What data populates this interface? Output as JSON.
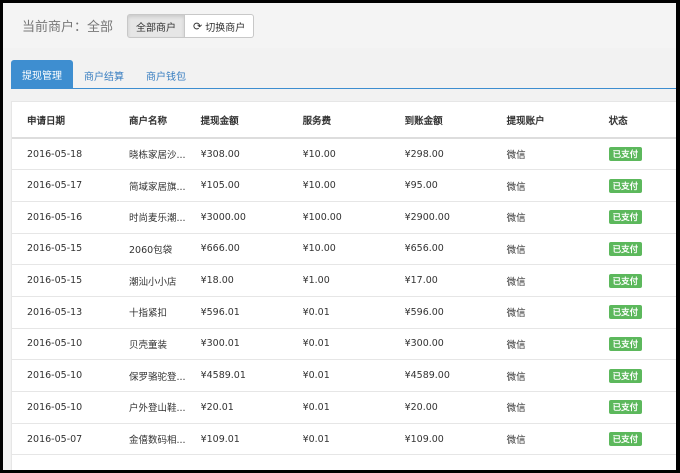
{
  "header": {
    "merchant_label": "当前商户：全部",
    "all_merchants_button": "全部商户",
    "switch_merchant_button": "切换商户"
  },
  "tabs": [
    {
      "label": "提现管理",
      "active": true
    },
    {
      "label": "商户结算",
      "active": false
    },
    {
      "label": "商户钱包",
      "active": false
    }
  ],
  "table": {
    "columns": [
      "申请日期",
      "商户名称",
      "提现金额",
      "服务费",
      "到账金额",
      "提现账户",
      "状态"
    ],
    "rows": [
      [
        "2016-05-18",
        "晓栋家居沙...",
        "¥308.00",
        "¥10.00",
        "¥298.00",
        "微信",
        "已支付"
      ],
      [
        "2016-05-17",
        "简域家居旗...",
        "¥105.00",
        "¥10.00",
        "¥95.00",
        "微信",
        "已支付"
      ],
      [
        "2016-05-16",
        "时尚麦乐潮...",
        "¥3000.00",
        "¥100.00",
        "¥2900.00",
        "微信",
        "已支付"
      ],
      [
        "2016-05-15",
        "2060包袋",
        "¥666.00",
        "¥10.00",
        "¥656.00",
        "微信",
        "已支付"
      ],
      [
        "2016-05-15",
        "潮汕小小店",
        "¥18.00",
        "¥1.00",
        "¥17.00",
        "微信",
        "已支付"
      ],
      [
        "2016-05-13",
        "十指紧扣",
        "¥596.01",
        "¥0.01",
        "¥596.00",
        "微信",
        "已支付"
      ],
      [
        "2016-05-10",
        "贝壳童装",
        "¥300.01",
        "¥0.01",
        "¥300.00",
        "微信",
        "已支付"
      ],
      [
        "2016-05-10",
        "保罗骆驼登...",
        "¥4589.01",
        "¥0.01",
        "¥4589.00",
        "微信",
        "已支付"
      ],
      [
        "2016-05-10",
        "户外登山鞋...",
        "¥20.01",
        "¥0.01",
        "¥20.00",
        "微信",
        "已支付"
      ],
      [
        "2016-05-07",
        "金僖数码相...",
        "¥109.01",
        "¥0.01",
        "¥109.00",
        "微信",
        "已支付"
      ]
    ]
  },
  "colors": {
    "accent": "#3e8ed0",
    "paid_badge": "#5cb85c"
  },
  "icons": {
    "switch_merchant": "refresh-icon"
  }
}
